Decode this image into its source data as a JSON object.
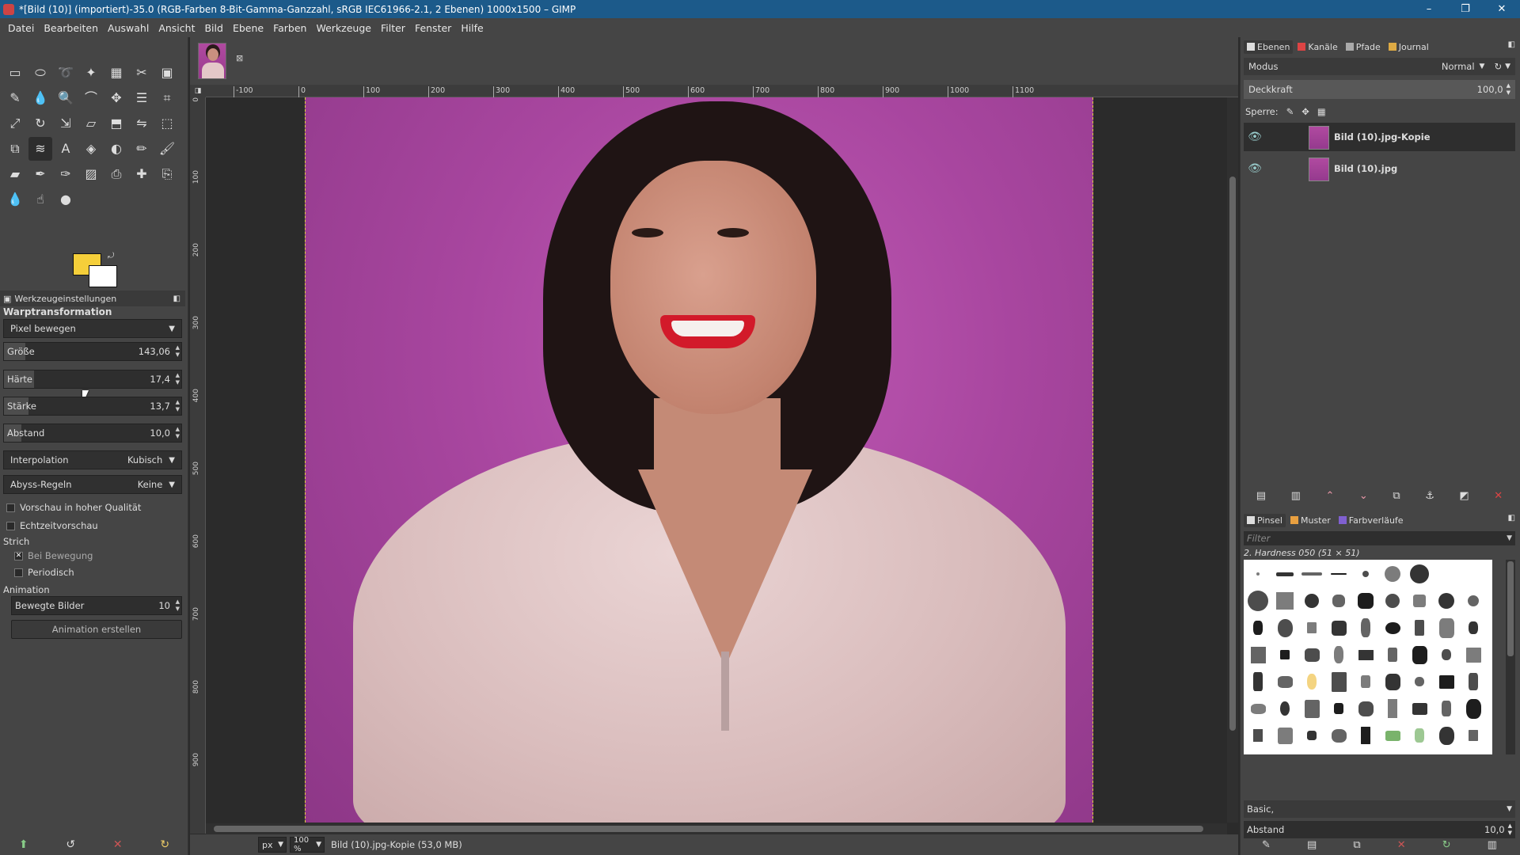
{
  "window": {
    "title": "*[Bild (10)] (importiert)-35.0 (RGB-Farben 8-Bit-Gamma-Ganzzahl, sRGB IEC61966-2.1, 2 Ebenen) 1000x1500 – GIMP",
    "minimize": "–",
    "maximize": "❐",
    "close": "✕"
  },
  "menu": [
    "Datei",
    "Bearbeiten",
    "Auswahl",
    "Ansicht",
    "Bild",
    "Ebene",
    "Farben",
    "Werkzeuge",
    "Filter",
    "Fenster",
    "Hilfe"
  ],
  "toolbox": {
    "tools": [
      {
        "icon": "rect-select-icon",
        "glyph": "▭"
      },
      {
        "icon": "ellipse-select-icon",
        "glyph": "⬭"
      },
      {
        "icon": "lasso-icon",
        "glyph": "➰"
      },
      {
        "icon": "fuzzy-select-icon",
        "glyph": "✦"
      },
      {
        "icon": "color-select-icon",
        "glyph": "▦"
      },
      {
        "icon": "scissors-icon",
        "glyph": "✂"
      },
      {
        "icon": "foreground-select-icon",
        "glyph": "▣"
      },
      {
        "icon": "paths-icon",
        "glyph": "✎"
      },
      {
        "icon": "color-picker-icon",
        "glyph": "💧"
      },
      {
        "icon": "zoom-icon",
        "glyph": "🔍"
      },
      {
        "icon": "measure-icon",
        "glyph": "⌒"
      },
      {
        "icon": "move-icon",
        "glyph": "✥"
      },
      {
        "icon": "align-icon",
        "glyph": "☰"
      },
      {
        "icon": "crop-icon",
        "glyph": "⌗"
      },
      {
        "icon": "unified-transform-icon",
        "glyph": "⤢"
      },
      {
        "icon": "rotate-icon",
        "glyph": "↻"
      },
      {
        "icon": "scale-icon",
        "glyph": "⇲"
      },
      {
        "icon": "shear-icon",
        "glyph": "▱"
      },
      {
        "icon": "perspective-icon",
        "glyph": "⬒"
      },
      {
        "icon": "flip-icon",
        "glyph": "⇋"
      },
      {
        "icon": "cage-icon",
        "glyph": "⬚"
      },
      {
        "icon": "handle-transform-icon",
        "glyph": "⧉"
      },
      {
        "icon": "warp-transform-icon",
        "glyph": "≋"
      },
      {
        "icon": "text-icon",
        "glyph": "A"
      },
      {
        "icon": "bucket-fill-icon",
        "glyph": "◈"
      },
      {
        "icon": "gradient-icon",
        "glyph": "◐"
      },
      {
        "icon": "pencil-icon",
        "glyph": "✏"
      },
      {
        "icon": "paintbrush-icon",
        "glyph": "🖌"
      },
      {
        "icon": "eraser-icon",
        "glyph": "▰"
      },
      {
        "icon": "airbrush-icon",
        "glyph": "✒"
      },
      {
        "icon": "ink-icon",
        "glyph": "✑"
      },
      {
        "icon": "mypaint-brush-icon",
        "glyph": "▨"
      },
      {
        "icon": "clone-icon",
        "glyph": "⎙"
      },
      {
        "icon": "heal-icon",
        "glyph": "✚"
      },
      {
        "icon": "perspective-clone-icon",
        "glyph": "⎘"
      },
      {
        "icon": "blur-icon",
        "glyph": "💧"
      },
      {
        "icon": "smudge-icon",
        "glyph": "☝"
      },
      {
        "icon": "dodge-burn-icon",
        "glyph": "●"
      }
    ],
    "active_index": 22,
    "fg_color": "#f5cf3a",
    "bg_color": "#ffffff",
    "options_tab": "Werkzeugeinstellungen",
    "tool_name": "Warptransformation",
    "mode_dropdown": "Pixel bewegen",
    "sliders": [
      {
        "label": "Größe",
        "value": "143,06",
        "fraction": 0.12
      },
      {
        "label": "Härte",
        "value": "17,4",
        "fraction": 0.17
      },
      {
        "label": "Stärke",
        "value": "13,7",
        "fraction": 0.14
      },
      {
        "label": "Abstand",
        "value": "10,0",
        "fraction": 0.1
      }
    ],
    "interpolation": {
      "label": "Interpolation",
      "value": "Kubisch"
    },
    "abyss": {
      "label": "Abyss-Regeln",
      "value": "Keine"
    },
    "checks": [
      {
        "label": "Vorschau in hoher Qualität",
        "checked": false
      },
      {
        "label": "Echtzeitvorschau",
        "checked": false
      }
    ],
    "stroke_label": "Strich",
    "stroke_checks": [
      {
        "label": "Bei Bewegung",
        "checked": true
      },
      {
        "label": "Periodisch",
        "checked": false
      }
    ],
    "animation_label": "Animation",
    "frames": {
      "label": "Bewegte Bilder",
      "value": "10"
    },
    "create_anim": "Animation erstellen"
  },
  "canvas": {
    "ruler_h": [
      "-100",
      "0",
      "100",
      "200",
      "300",
      "400",
      "500",
      "600",
      "700",
      "800",
      "900",
      "1000",
      "1100"
    ],
    "ruler_v": [
      "0",
      "100",
      "200",
      "300",
      "400",
      "500",
      "600",
      "700",
      "800",
      "900"
    ]
  },
  "status": {
    "unit": "px",
    "zoom": "100 %",
    "info": "Bild (10).jpg-Kopie (53,0 MB)"
  },
  "dock": {
    "tabs": [
      "Ebenen",
      "Kanäle",
      "Pfade",
      "Journal"
    ],
    "mode_label": "Modus",
    "mode_value": "Normal",
    "opacity_label": "Deckkraft",
    "opacity_value": "100,0",
    "lock_label": "Sperre:",
    "layers": [
      {
        "name": "Bild (10).jpg-Kopie",
        "active": true
      },
      {
        "name": "Bild (10).jpg",
        "active": false
      }
    ],
    "brush_tabs": [
      "Pinsel",
      "Muster",
      "Farbverläufe"
    ],
    "filter_placeholder": "Filter",
    "brush_name": "2. Hardness 050 (51 × 51)",
    "brush_tag": "Basic,",
    "spacing_label": "Abstand",
    "spacing_value": "10,0"
  }
}
